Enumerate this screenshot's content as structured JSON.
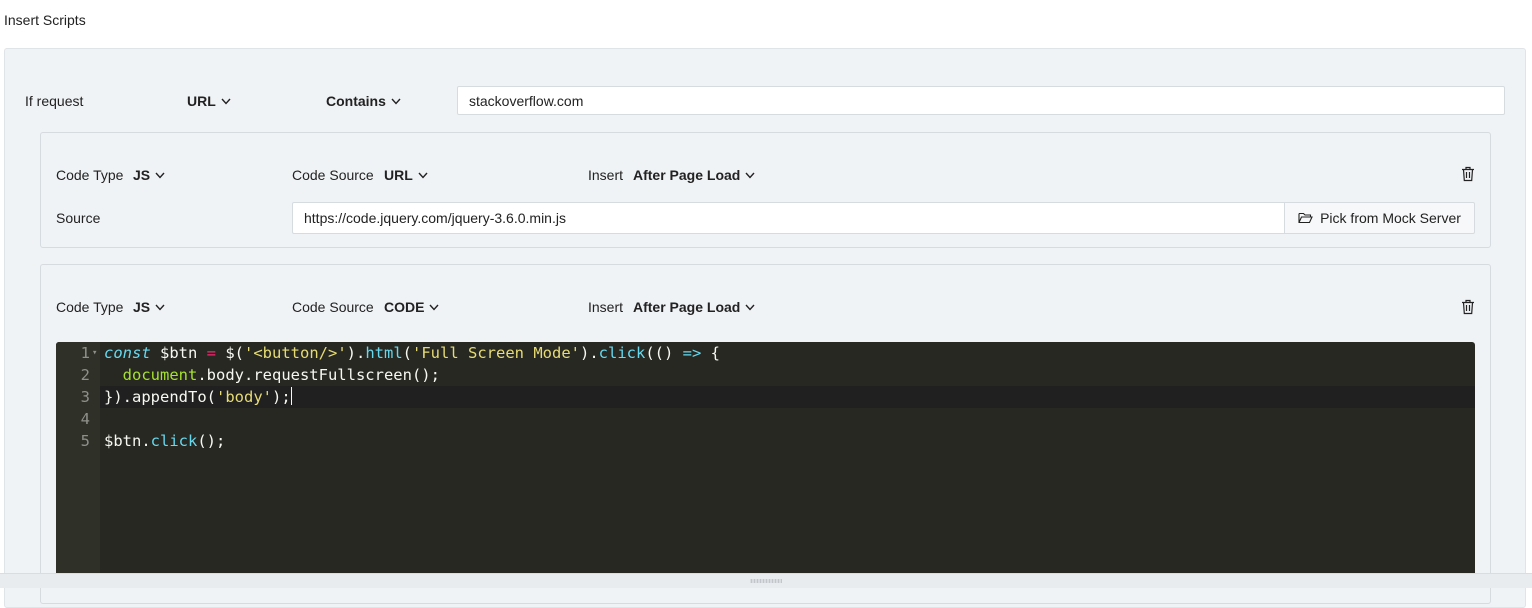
{
  "page": {
    "title": "Insert Scripts"
  },
  "request": {
    "label": "If request",
    "field": "URL",
    "operator": "Contains",
    "value": "stackoverflow.com"
  },
  "scripts": [
    {
      "code_type_label": "Code Type",
      "code_type": "JS",
      "code_source_label": "Code Source",
      "code_source": "URL",
      "insert_label": "Insert",
      "insert": "After Page Load",
      "source_label": "Source",
      "source_value": "https://code.jquery.com/jquery-3.6.0.min.js",
      "pick_button": "Pick from Mock Server"
    },
    {
      "code_type_label": "Code Type",
      "code_type": "JS",
      "code_source_label": "Code Source",
      "code_source": "CODE",
      "insert_label": "Insert",
      "insert": "After Page Load",
      "code_lines": [
        "const $btn = $('<button/>').html('Full Screen Mode').click(() => {",
        "  document.body.requestFullscreen();",
        "}).appendTo('body');",
        "",
        "$btn.click();"
      ],
      "line_numbers": [
        "1",
        "2",
        "3",
        "4",
        "5"
      ]
    }
  ],
  "icons": {
    "chevron": "chevron-down-icon",
    "trash": "trash-icon",
    "folder": "folder-open-icon",
    "grip": "resize-grip-icon"
  },
  "colors": {
    "panel_bg": "#f0f3f6",
    "editor_bg": "#272822",
    "keyword": "#66d9ef",
    "string": "#e6db74",
    "operator": "#f92672",
    "global": "#a6e22e"
  }
}
